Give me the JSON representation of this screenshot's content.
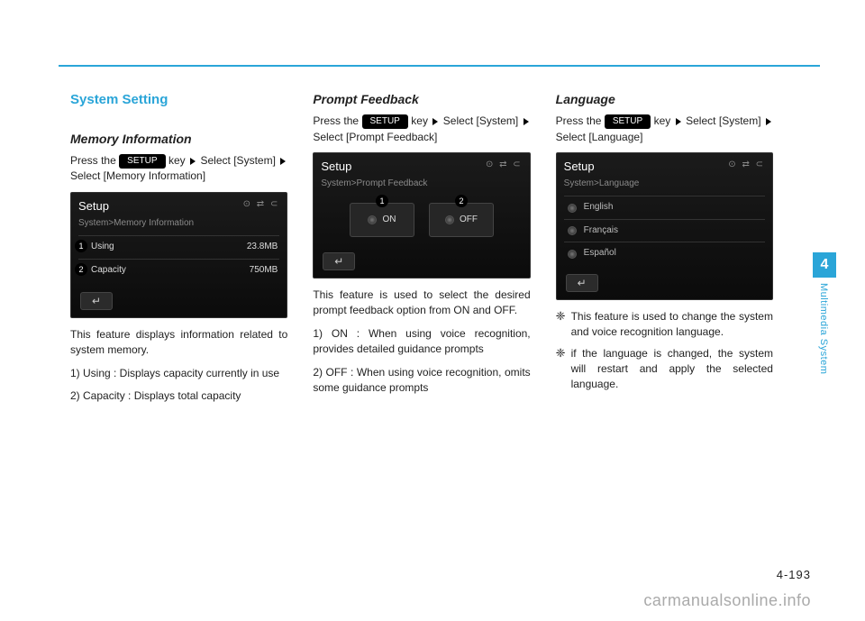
{
  "page": {
    "number": "4-193",
    "chapter_number": "4",
    "chapter_title": "Multimedia System",
    "watermark": "carmanualsonline.info"
  },
  "setup_key_label": "SETUP",
  "col1": {
    "section_title": "System Setting",
    "subhead": "Memory Information",
    "instr_pre": "Press the ",
    "instr_post": " key",
    "path_a": "Select [System]",
    "path_b": "Select [Memory Information]",
    "screen": {
      "title": "Setup",
      "icons": "⊙  ⇄ ⊂",
      "crumb": "System>Memory Information",
      "row1_label": "Using",
      "row1_value": "23.8MB",
      "row2_label": "Capacity",
      "row2_value": "750MB",
      "back": "↵",
      "marker1": "1",
      "marker2": "2"
    },
    "desc": "This feature displays information related to system memory.",
    "items": [
      "1) Using : Displays capacity currently in use",
      "2) Capacity : Displays total capacity"
    ]
  },
  "col2": {
    "subhead": "Prompt Feedback",
    "instr_pre": "Press the ",
    "instr_post": " key",
    "path_a": "Select [System]",
    "path_b": "Select [Prompt Feedback]",
    "screen": {
      "title": "Setup",
      "icons": "⊙  ⇄ ⊂",
      "crumb": "System>Prompt Feedback",
      "opt1": "ON",
      "opt2": "OFF",
      "back": "↵",
      "marker1": "1",
      "marker2": "2"
    },
    "desc": "This feature is used to select the desired prompt feedback option from ON and OFF.",
    "items": [
      "1) ON : When using voice recognition, provides detailed guidance prompts",
      "2) OFF : When using voice recognition, omits some guidance prompts"
    ]
  },
  "col3": {
    "subhead": "Language",
    "instr_pre": "Press the ",
    "instr_post": " key",
    "path_a": "Select [System]",
    "path_b": "Select [Language]",
    "screen": {
      "title": "Setup",
      "icons": "⊙  ⇄ ⊂",
      "crumb": "System>Language",
      "langs": [
        "English",
        "Français",
        "Español"
      ],
      "back": "↵"
    },
    "bullets": [
      "This feature is used to change the system and voice recognition language.",
      "if the language is changed, the system will restart and apply the selected language."
    ],
    "bullet_symbol": "❈"
  }
}
